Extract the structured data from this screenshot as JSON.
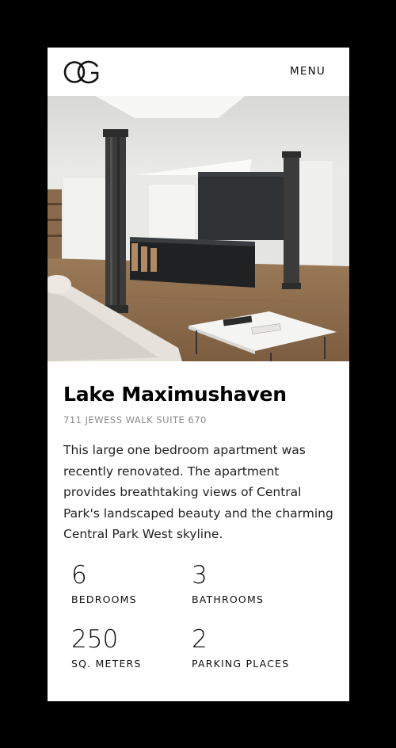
{
  "header": {
    "logo_icon": "oc-monogram-logo",
    "menu_label": "MENU"
  },
  "hero": {
    "image_alt": "loft-interior-photo"
  },
  "listing": {
    "title": "Lake Maximushaven",
    "address": "711 JEWESS WALK SUITE 670",
    "description": "This large one bedroom apartment was recently renovated. The apartment provides breathtaking views of Central Park's landscaped beauty and the charming Central Park West skyline."
  },
  "stats": [
    {
      "value": "6",
      "label": "BEDROOMS"
    },
    {
      "value": "3",
      "label": "BATHROOMS"
    },
    {
      "value": "250",
      "label": "SQ. METERS"
    },
    {
      "value": "2",
      "label": "PARKING PLACES"
    }
  ]
}
